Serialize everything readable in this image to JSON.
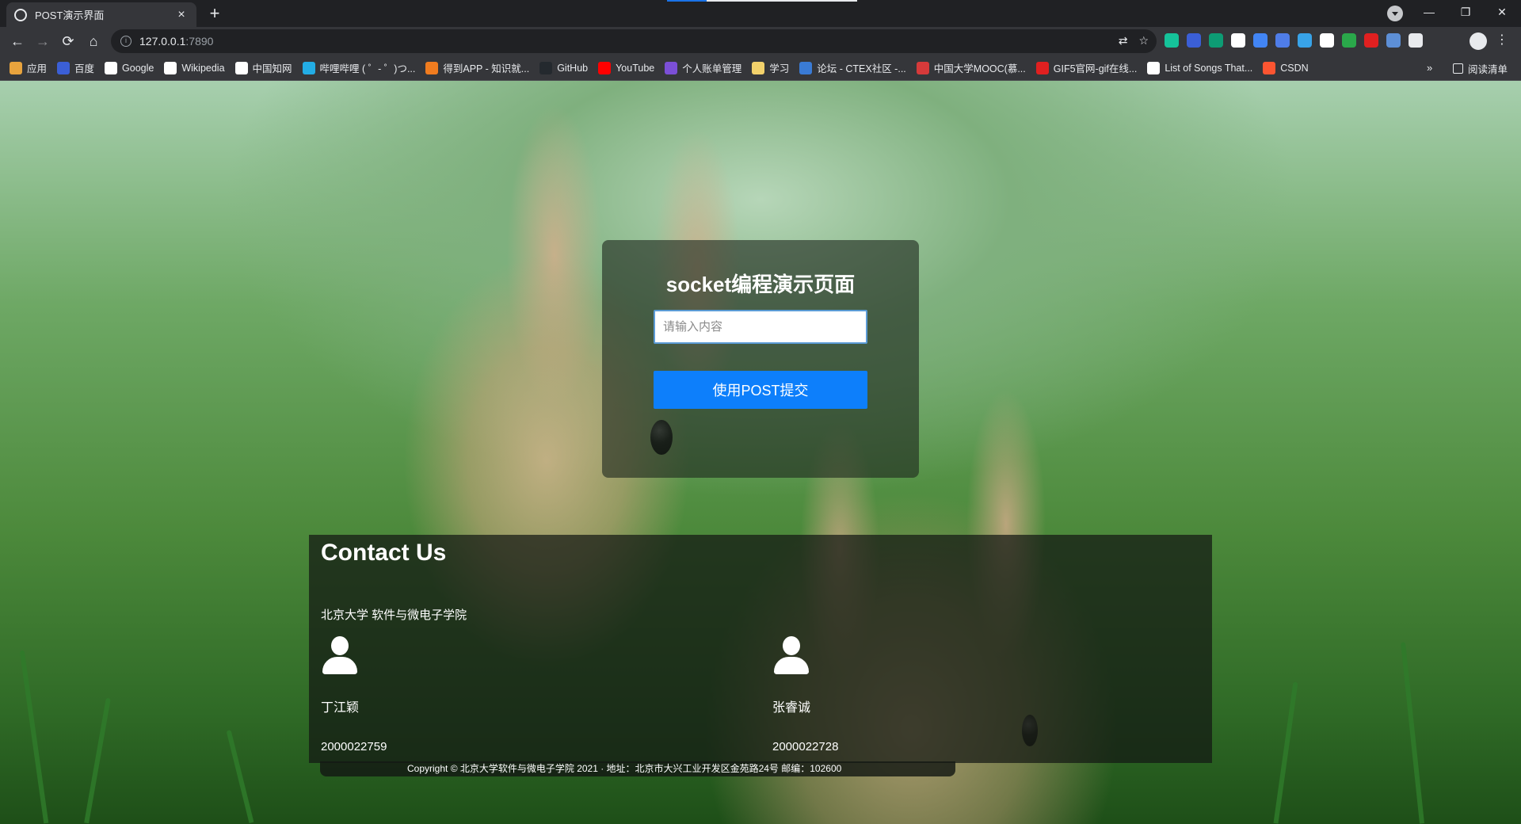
{
  "browser": {
    "tab_title": "POST演示界面",
    "tab_close": "×",
    "new_tab": "+",
    "url_host": "127.0.0.1",
    "url_port": ":7890",
    "window_controls": {
      "minimize": "—",
      "maximize": "❐",
      "close": "✕"
    },
    "nav": {
      "back": "←",
      "forward": "→",
      "reload": "⟳",
      "home": "⌂"
    },
    "menu": "⋮",
    "bookmarks_more": "»",
    "reading_list": "阅读清单"
  },
  "bookmarks": [
    {
      "label": "应用",
      "color": "#e8a33d"
    },
    {
      "label": "百度",
      "color": "#3b5fd6"
    },
    {
      "label": "Google",
      "color": "#ffffff"
    },
    {
      "label": "Wikipedia",
      "color": "#ffffff"
    },
    {
      "label": "中国知网",
      "color": "#ffffff"
    },
    {
      "label": "哔哩哔哩 ( ゜- ゜)つ...",
      "color": "#23ade5"
    },
    {
      "label": "得到APP - 知识就...",
      "color": "#f07c1f"
    },
    {
      "label": "GitHub",
      "color": "#24292e"
    },
    {
      "label": "YouTube",
      "color": "#ff0000"
    },
    {
      "label": "个人账单管理",
      "color": "#7b4fd6"
    },
    {
      "label": "学习",
      "color": "#f2d16b"
    },
    {
      "label": "论坛 - CTEX社区 -...",
      "color": "#3a7bd5"
    },
    {
      "label": "中国大学MOOC(慕...",
      "color": "#d63a3a"
    },
    {
      "label": "GIF5官网-gif在线...",
      "color": "#e02020"
    },
    {
      "label": "List of Songs That...",
      "color": "#ffffff"
    },
    {
      "label": "CSDN",
      "color": "#fc5531"
    }
  ],
  "extensions": [
    "#15c39a",
    "#3b5fd6",
    "#0d9c74",
    "#ffffff",
    "#4285f4",
    "#4f7de8",
    "#38a3e8",
    "#ffffff",
    "#2aa84a",
    "#e02020",
    "#5d8fd6",
    "#e8eaed"
  ],
  "login": {
    "title": "socket编程演示页面",
    "input_placeholder": "请输入内容",
    "input_value": "",
    "submit_label": "使用POST提交"
  },
  "contact": {
    "title": "Contact Us",
    "school": "北京大学 软件与微电子学院",
    "people": [
      {
        "name": "丁江颖",
        "id": "2000022759"
      },
      {
        "name": "张睿诚",
        "id": "2000022728"
      }
    ]
  },
  "footer": {
    "copyright": "Copyright © 北京大学软件与微电子学院 2021 · 地址：北京市大兴工业开发区金苑路24号 邮编：102600"
  }
}
